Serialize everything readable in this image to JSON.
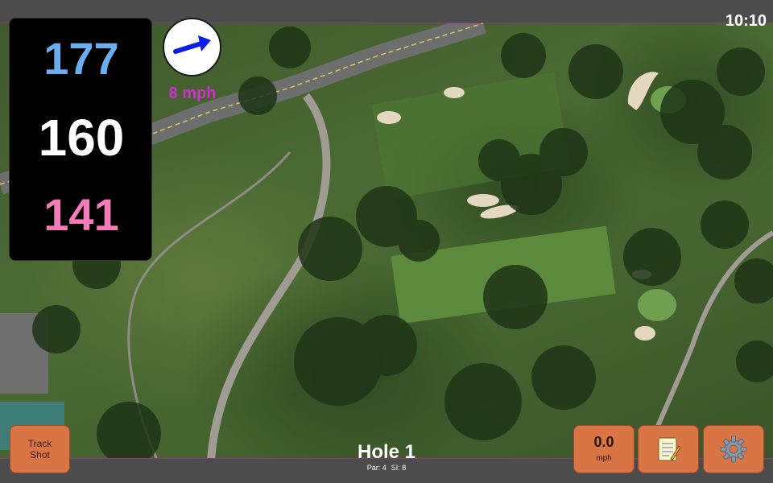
{
  "status": {
    "time": "10:10"
  },
  "distances": {
    "back": "177",
    "middle": "160",
    "front": "141",
    "back_color": "#6aaef0",
    "middle_color": "#ffffff",
    "front_color": "#f47cb9"
  },
  "wind": {
    "speed": "8 mph",
    "icon": "arrow-right-icon",
    "arrow_color": "#0a1ee6",
    "speed_color": "#cc33cc"
  },
  "track_shot": {
    "label": "Track\nShot"
  },
  "hole": {
    "title": "Hole 1",
    "par": "Par: 4",
    "si": "SI: 8"
  },
  "speed_button": {
    "value": "0.0",
    "unit": "mph"
  },
  "notes_button": {
    "icon": "notepad-icon"
  },
  "settings_button": {
    "icon": "gear-icon"
  },
  "colors": {
    "button_fill": "#d97544",
    "button_text": "#2a1408"
  }
}
